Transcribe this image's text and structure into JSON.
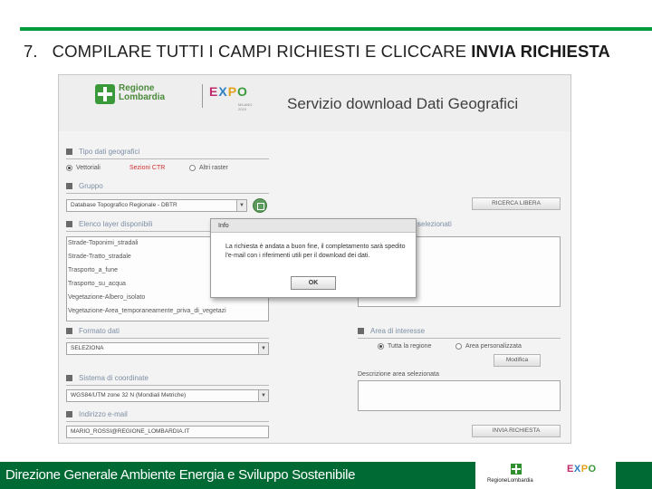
{
  "slide": {
    "number": "7.",
    "title_plain": "COMPILARE TUTTI I CAMPI RICHIESTI E CLICCARE",
    "title_bold": "INVIA RICHIESTA",
    "footer": "Direzione Generale Ambiente Energia e Sviluppo Sostenibile",
    "accent_color": "#009b3a",
    "footer_color": "#006a35"
  },
  "logos": {
    "regione": "Regione Lombardia",
    "expo": "EXPO",
    "expo_sub": "MILANO 2015",
    "footer_regione": "RegioneLombardia"
  },
  "app": {
    "service_title": "Servizio download Dati Geografici",
    "sections": {
      "tipo": "Tipo dati geografici",
      "gruppo": "Gruppo",
      "layers": "Elenco layer disponibili",
      "selected": "selezionati",
      "formato": "Formato dati",
      "area": "Area di interesse",
      "coordinate": "Sistema di coordinate",
      "email": "Indirizzo e-mail"
    },
    "tipo_options": [
      "Vettoriali",
      "Sezioni CTR",
      "Altri raster"
    ],
    "gruppo_value": "Database Topografico Regionale - DBTR",
    "layers": [
      "Strade-Toponimi_stradali",
      "Strade-Tratto_stradale",
      "Trasporto_a_fune",
      "Trasporto_su_acqua",
      "Vegetazione-Albero_isolato",
      "Vegetazione-Area_temporaneamente_priva_di_vegetazi"
    ],
    "formato_value": "SELEZIONA",
    "area_options": [
      "Tutta la regione",
      "Area personalizzata"
    ],
    "modifica_label": "Modifica",
    "area_desc_label": "Descrizione area selezionata",
    "coordinate_value": "WGS84/UTM zone 32 N (Mondiali Metriche)",
    "email_value": "MARIO_ROSSI@REGIONE_LOMBARDIA.IT",
    "ricerca_label": "RICERCA LIBERA",
    "invia_label": "INVIA RICHIESTA"
  },
  "dialog": {
    "title": "Info",
    "message": "La richiesta è andata a buon fine, il completamento sarà spedito l'e-mail con i riferimenti utili per il download dei dati.",
    "ok_label": "OK"
  }
}
